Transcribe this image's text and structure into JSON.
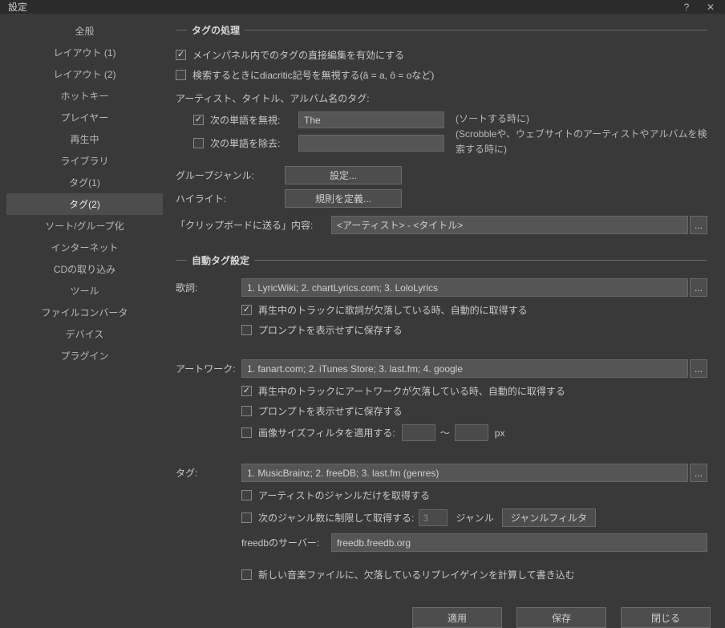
{
  "title": "設定",
  "sidebar": {
    "items": [
      {
        "label": "全般"
      },
      {
        "label": "レイアウト (1)"
      },
      {
        "label": "レイアウト (2)"
      },
      {
        "label": "ホットキー"
      },
      {
        "label": "プレイヤー"
      },
      {
        "label": "再生中"
      },
      {
        "label": "ライブラリ"
      },
      {
        "label": "タグ(1)"
      },
      {
        "label": "タグ(2)"
      },
      {
        "label": "ソート/グループ化"
      },
      {
        "label": "インターネット"
      },
      {
        "label": "CDの取り込み"
      },
      {
        "label": "ツール"
      },
      {
        "label": "ファイルコンバータ"
      },
      {
        "label": "デバイス"
      },
      {
        "label": "プラグイン"
      }
    ]
  },
  "tag_processing": {
    "title": "タグの処理",
    "enable_direct_edit": "メインパネル内でのタグの直接編集を有効にする",
    "ignore_diacritics": "検索するときにdiacritic記号を無視する(â = a, ô = oなど)",
    "artist_title_album": "アーティスト、タイトル、アルバム名のタグ:",
    "ignore_words_label": "次の単語を無視:",
    "ignore_words_value": "The",
    "remove_words_label": "次の単語を除去:",
    "remove_words_value": "",
    "hint_sort": "(ソートする時に)",
    "hint_scrobble": "(Scrobbleや、ウェブサイトのアーティストやアルバムを検索する時に)",
    "group_genre_label": "グループジャンル:",
    "group_genre_btn": "設定...",
    "highlight_label": "ハイライト:",
    "highlight_btn": "規則を定義...",
    "clipboard_label": "「クリップボードに送る」内容:",
    "clipboard_value": "<アーティスト> - <タイトル>"
  },
  "auto_tag": {
    "title": "自動タグ設定",
    "lyrics": {
      "label": "歌詞:",
      "sources": "1. LyricWiki; 2. chartLyrics.com; 3. LoloLyrics",
      "auto_fetch": "再生中のトラックに歌詞が欠落している時、自動的に取得する",
      "save_silent": "プロンプトを表示せずに保存する"
    },
    "artwork": {
      "label": "アートワーク:",
      "sources": "1. fanart.com; 2. iTunes Store; 3. last.fm; 4. google",
      "auto_fetch": "再生中のトラックにアートワークが欠落している時、自動的に取得する",
      "save_silent": "プロンプトを表示せずに保存する",
      "size_filter": "画像サイズフィルタを適用する:",
      "size_from": "",
      "size_to": "",
      "px": "px"
    },
    "tags": {
      "label": "タグ:",
      "sources": "1. MusicBrainz; 2. freeDB; 3. last.fm (genres)",
      "artist_genre_only": "アーティストのジャンルだけを取得する",
      "limit_genres_label": "次のジャンル数に制限して取得する:",
      "limit_genres_value": "3",
      "genre_unit": "ジャンル",
      "genre_filter_btn": "ジャンルフィルタ",
      "freedb_label": "freedbのサーバー:",
      "freedb_value": "freedb.freedb.org"
    },
    "replaygain": "新しい音楽ファイルに、欠落しているリプレイゲインを計算して書き込む"
  },
  "footer": {
    "apply": "適用",
    "save": "保存",
    "close": "閉じる"
  }
}
